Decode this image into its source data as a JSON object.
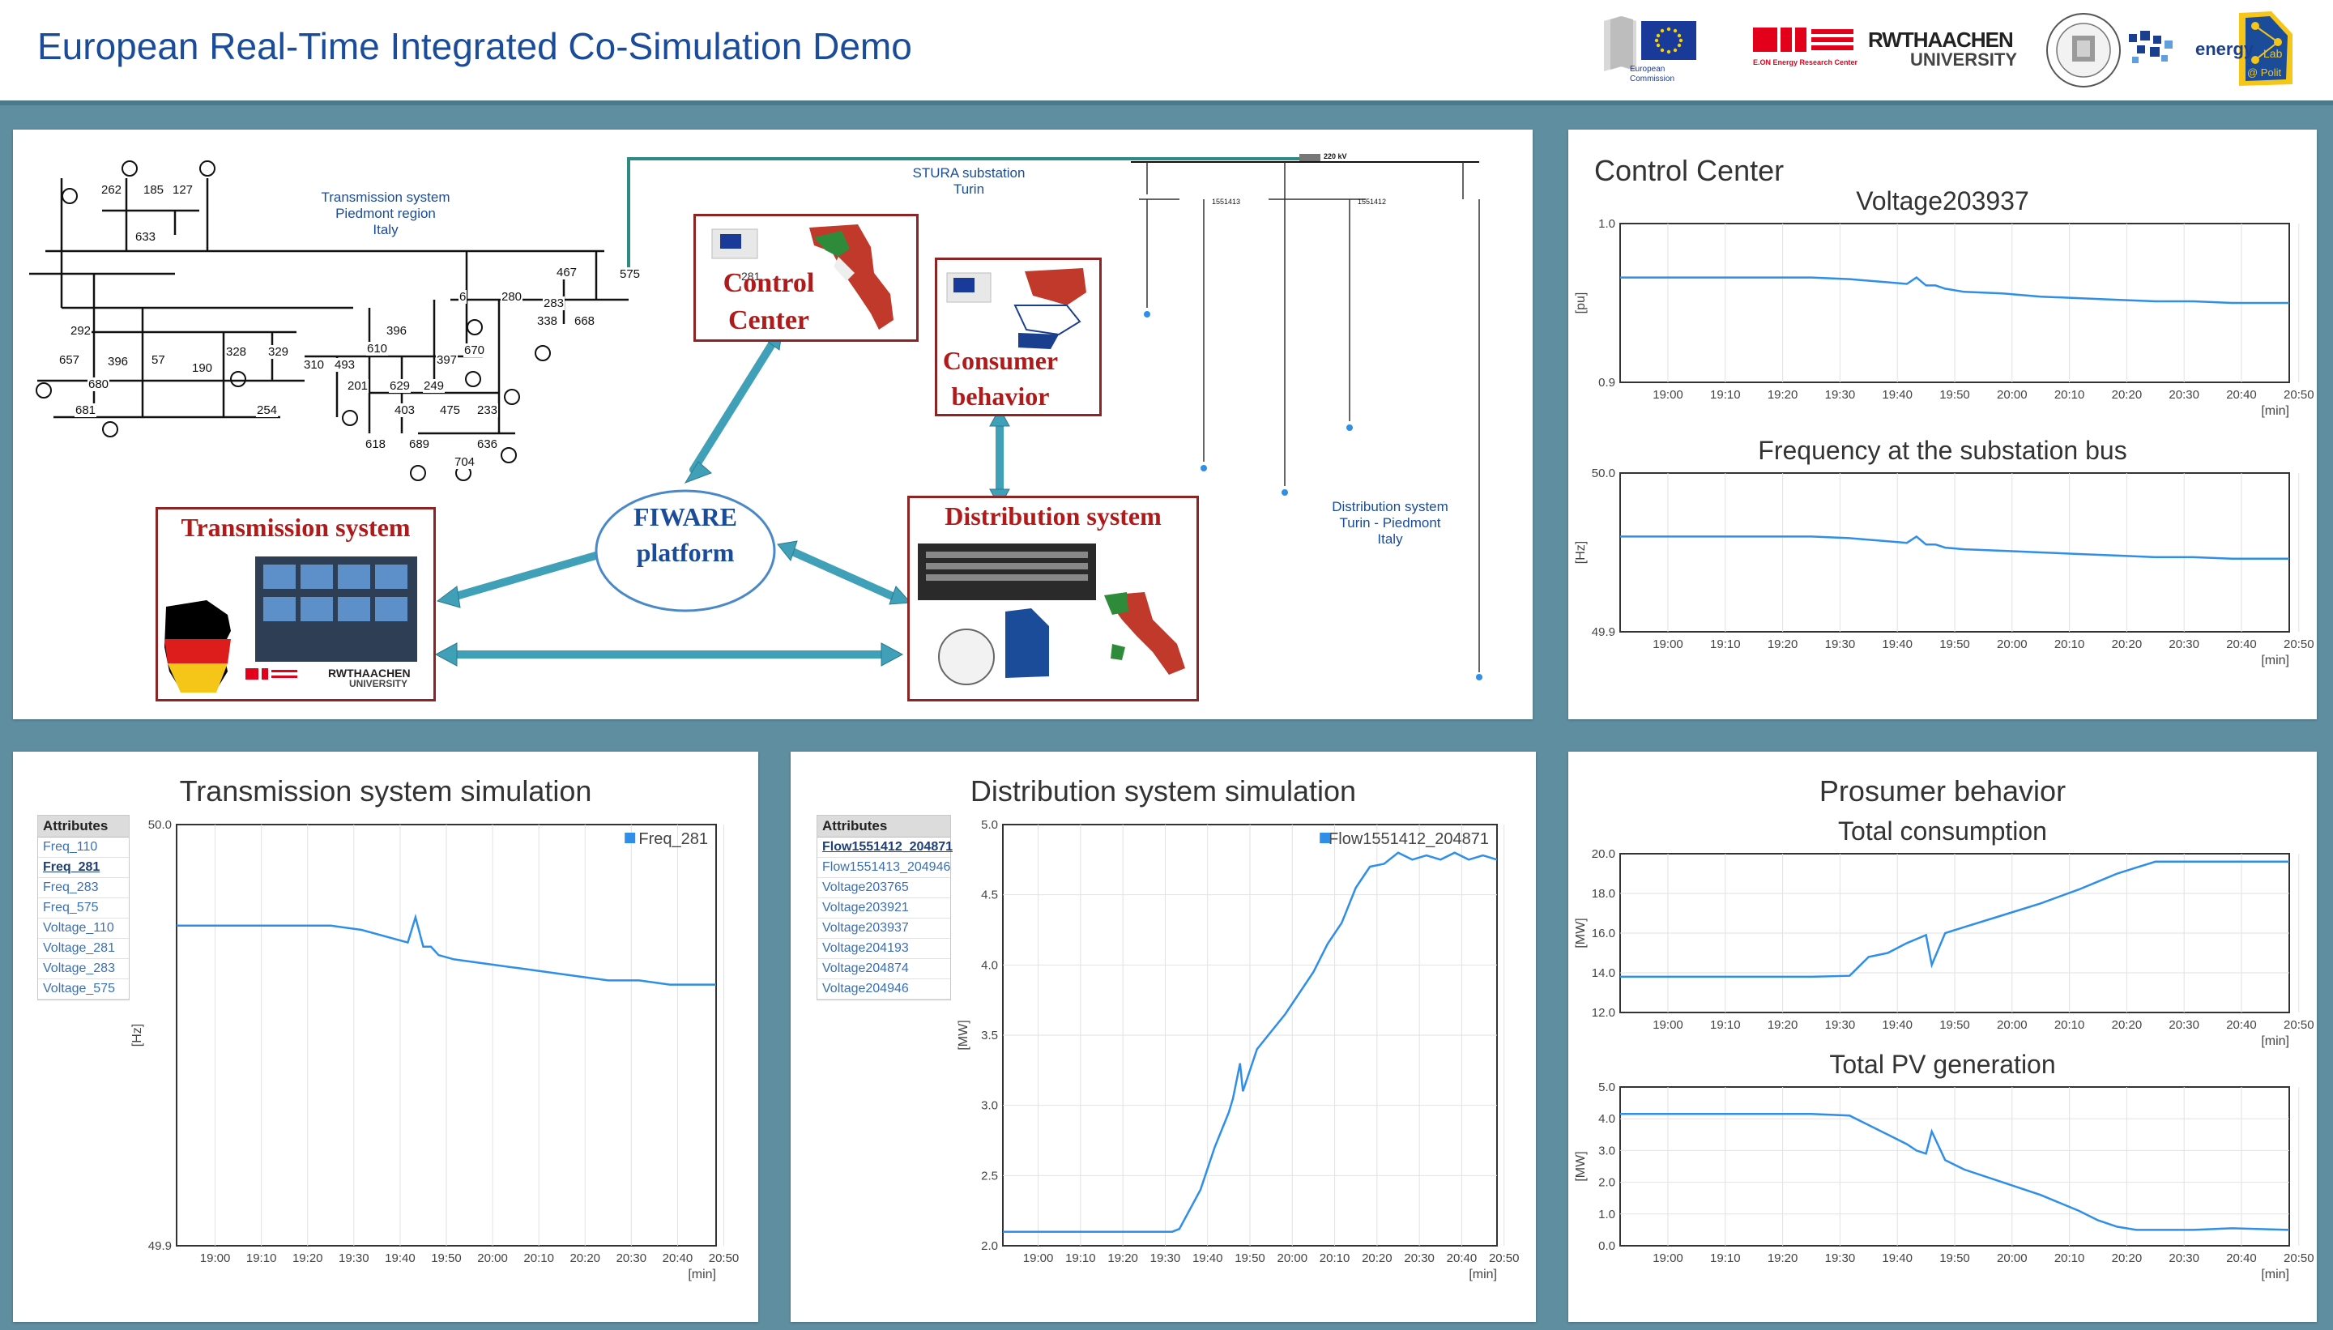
{
  "header": {
    "title": "European Real-Time Integrated Co-Simulation Demo",
    "logos": {
      "ec_line1": "European",
      "ec_line2": "Commission",
      "eon": "E.ON Energy Research Center",
      "rwth_line1": "RWTHAACHEN",
      "rwth_line2": "UNIVERSITY",
      "energy": "energy",
      "lab": "Lab",
      "polito": "@ Polit"
    }
  },
  "diagram": {
    "transmission_caption": [
      "Transmission system",
      "Piedmont region",
      "Italy"
    ],
    "stura_caption": [
      "STURA substation",
      "Turin"
    ],
    "distribution_caption": [
      "Distribution system",
      "Turin - Piedmont",
      "Italy"
    ],
    "kv_label": "220 kV",
    "bus_numbers": [
      "262",
      "185",
      "127",
      "633",
      "467",
      "575",
      "6",
      "280",
      "283",
      "338",
      "668",
      "292",
      "396",
      "670",
      "657",
      "396",
      "57",
      "190",
      "328",
      "329",
      "310",
      "493",
      "610",
      "397",
      "680",
      "201",
      "629",
      "249",
      "681",
      "254",
      "403",
      "475",
      "233",
      "618",
      "689",
      "636",
      "704"
    ],
    "feeder_ids": [
      "1551413",
      "1551412"
    ],
    "control_center_label": [
      "Control",
      "Center"
    ],
    "consumer_label": [
      "Consumer",
      "behavior"
    ],
    "fiware_label": [
      "FIWARE",
      "platform"
    ],
    "distribution_label": "Distribution system",
    "transmission_label": "Transmission system",
    "cc_number": "281"
  },
  "control_center": {
    "title": "Control Center",
    "voltage_title": "Voltage203937",
    "frequency_title": "Frequency at the substation bus"
  },
  "transmission_panel": {
    "title": "Transmission system simulation",
    "attributes_header": "Attributes",
    "attributes": [
      "Freq_110",
      "Freq_281",
      "Freq_283",
      "Freq_575",
      "Voltage_110",
      "Voltage_281",
      "Voltage_283",
      "Voltage_575"
    ],
    "selected": "Freq_281"
  },
  "distribution_panel": {
    "title": "Distribution system simulation",
    "attributes_header": "Attributes",
    "attributes": [
      "Flow1551412_204871",
      "Flow1551413_204946",
      "Voltage203765",
      "Voltage203921",
      "Voltage203937",
      "Voltage204193",
      "Voltage204874",
      "Voltage204946"
    ],
    "selected": "Flow1551412_204871"
  },
  "prosumer_panel": {
    "title": "Prosumer behavior",
    "consumption_title": "Total consumption",
    "pv_title": "Total PV generation"
  },
  "colors": {
    "series": "#2f8fe8",
    "panel_title": "#333333",
    "band": "#5e8ea0",
    "accent_red": "#b01a1a"
  },
  "chart_data": [
    {
      "type": "line",
      "id": "cc_voltage",
      "ylabel": "[pu]",
      "ylim": [
        0.9,
        1.0
      ],
      "yticks": [
        "1.0",
        "0.9"
      ],
      "xticks": [
        "19:00",
        "19:10",
        "19:20",
        "19:30",
        "19:40",
        "19:50",
        "20:00",
        "20:10",
        "20:20",
        "20:30",
        "20:40",
        "20:50"
      ],
      "xunit": "[min]",
      "x": [
        0,
        2,
        4,
        6,
        8,
        10,
        12,
        14,
        15,
        15.5,
        16,
        16.5,
        17,
        18,
        20,
        22,
        24,
        26,
        28,
        30,
        32,
        35
      ],
      "values": [
        0.966,
        0.966,
        0.966,
        0.966,
        0.966,
        0.966,
        0.965,
        0.963,
        0.962,
        0.966,
        0.961,
        0.961,
        0.959,
        0.957,
        0.956,
        0.954,
        0.953,
        0.952,
        0.951,
        0.951,
        0.95,
        0.95
      ]
    },
    {
      "type": "line",
      "id": "cc_frequency",
      "ylabel": "[Hz]",
      "ylim": [
        49.9,
        50.0
      ],
      "yticks": [
        "50.0",
        "49.9"
      ],
      "xticks": [
        "19:00",
        "19:10",
        "19:20",
        "19:30",
        "19:40",
        "19:50",
        "20:00",
        "20:10",
        "20:20",
        "20:30",
        "20:40",
        "20:50"
      ],
      "xunit": "[min]",
      "x": [
        0,
        2,
        4,
        6,
        8,
        10,
        12,
        14,
        15,
        15.5,
        16,
        16.5,
        17,
        18,
        20,
        22,
        24,
        26,
        28,
        30,
        32,
        35
      ],
      "values": [
        49.96,
        49.96,
        49.96,
        49.96,
        49.96,
        49.96,
        49.959,
        49.957,
        49.956,
        49.96,
        49.955,
        49.955,
        49.953,
        49.952,
        49.951,
        49.95,
        49.949,
        49.948,
        49.947,
        49.947,
        49.946,
        49.946
      ]
    },
    {
      "type": "line",
      "id": "ts_freq",
      "series_name": "Freq_281",
      "ylabel": "[Hz]",
      "ylim": [
        49.9,
        50.0
      ],
      "yticks": [
        "50.0",
        "49.9"
      ],
      "xticks": [
        "19:00",
        "19:10",
        "19:20",
        "19:30",
        "19:40",
        "19:50",
        "20:00",
        "20:10",
        "20:20",
        "20:30",
        "20:40",
        "20:50"
      ],
      "xunit": "[min]",
      "x": [
        0,
        2,
        4,
        6,
        8,
        10,
        12,
        14,
        15,
        15.5,
        16,
        16.5,
        17,
        18,
        20,
        22,
        24,
        26,
        28,
        30,
        32,
        35
      ],
      "values": [
        49.976,
        49.976,
        49.976,
        49.976,
        49.976,
        49.976,
        49.975,
        49.973,
        49.972,
        49.978,
        49.971,
        49.971,
        49.969,
        49.968,
        49.967,
        49.966,
        49.965,
        49.964,
        49.963,
        49.963,
        49.962,
        49.962
      ]
    },
    {
      "type": "line",
      "id": "ds_flow",
      "series_name": "Flow1551412_204871",
      "ylabel": "[MW]",
      "ylim": [
        2.0,
        5.0
      ],
      "yticks": [
        "5.0",
        "4.5",
        "4.0",
        "3.5",
        "3.0",
        "2.5",
        "2.0"
      ],
      "xticks": [
        "19:00",
        "19:10",
        "19:20",
        "19:30",
        "19:40",
        "19:50",
        "20:00",
        "20:10",
        "20:20",
        "20:30",
        "20:40",
        "20:50"
      ],
      "xunit": "[min]",
      "x": [
        0,
        2,
        4,
        6,
        8,
        10,
        12,
        12.5,
        14,
        15,
        15.8,
        16,
        16.3,
        16.8,
        17,
        18,
        20,
        22,
        23,
        24,
        25,
        26,
        27,
        28,
        29,
        30,
        31,
        32,
        33,
        34,
        35
      ],
      "values": [
        2.1,
        2.1,
        2.1,
        2.1,
        2.1,
        2.1,
        2.1,
        2.12,
        2.4,
        2.7,
        2.9,
        2.95,
        3.05,
        3.3,
        3.1,
        3.4,
        3.65,
        3.95,
        4.15,
        4.3,
        4.55,
        4.7,
        4.72,
        4.8,
        4.75,
        4.78,
        4.75,
        4.8,
        4.75,
        4.78,
        4.75
      ]
    },
    {
      "type": "line",
      "id": "ps_consumption",
      "ylabel": "[MW]",
      "ylim": [
        12.0,
        20.0
      ],
      "yticks": [
        "20.0",
        "18.0",
        "16.0",
        "14.0",
        "12.0"
      ],
      "xticks": [
        "19:00",
        "19:10",
        "19:20",
        "19:30",
        "19:40",
        "19:50",
        "20:00",
        "20:10",
        "20:20",
        "20:30",
        "20:40",
        "20:50"
      ],
      "xunit": "[min]",
      "x": [
        0,
        2,
        4,
        6,
        8,
        10,
        12,
        13,
        14,
        15,
        15.5,
        16,
        16.3,
        17,
        18,
        20,
        22,
        24,
        25,
        26,
        27,
        28,
        30,
        32,
        35
      ],
      "values": [
        13.8,
        13.8,
        13.8,
        13.8,
        13.8,
        13.8,
        13.85,
        14.8,
        15.0,
        15.5,
        15.7,
        15.9,
        14.4,
        16.0,
        16.3,
        16.9,
        17.5,
        18.2,
        18.6,
        19.0,
        19.3,
        19.6,
        19.6,
        19.6,
        19.6
      ]
    },
    {
      "type": "line",
      "id": "ps_pv",
      "ylabel": "[MW]",
      "ylim": [
        0.0,
        5.0
      ],
      "yticks": [
        "5.0",
        "4.0",
        "3.0",
        "2.0",
        "1.0",
        "0.0"
      ],
      "xticks": [
        "19:00",
        "19:10",
        "19:20",
        "19:30",
        "19:40",
        "19:50",
        "20:00",
        "20:10",
        "20:20",
        "20:30",
        "20:40",
        "20:50"
      ],
      "xunit": "[min]",
      "x": [
        0,
        2,
        4,
        6,
        8,
        10,
        12,
        13,
        14,
        15,
        15.5,
        16,
        16.3,
        17,
        18,
        20,
        22,
        24,
        25,
        26,
        27,
        28,
        30,
        32,
        35
      ],
      "values": [
        4.15,
        4.15,
        4.15,
        4.15,
        4.15,
        4.15,
        4.1,
        3.8,
        3.5,
        3.2,
        3.0,
        2.9,
        3.6,
        2.7,
        2.4,
        2.0,
        1.6,
        1.1,
        0.8,
        0.6,
        0.5,
        0.5,
        0.5,
        0.55,
        0.5
      ]
    }
  ]
}
